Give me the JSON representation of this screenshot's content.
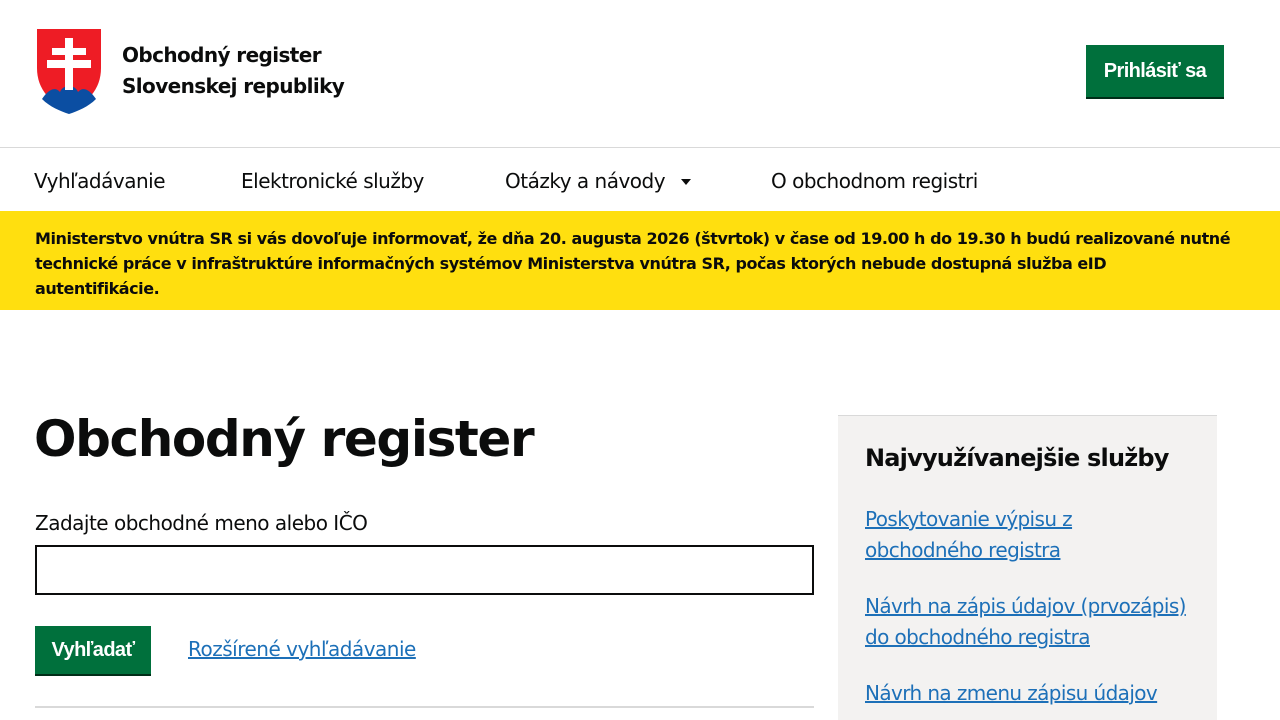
{
  "header": {
    "brand_line1": "Obchodný register",
    "brand_line2": "Slovenskej republiky",
    "login_label": "Prihlásiť sa",
    "logo_icon": "slovak-coat-of-arms",
    "accent_color": "#00703c"
  },
  "nav": {
    "items": [
      {
        "label": "Vyhľadávanie"
      },
      {
        "label": "Elektronické služby"
      },
      {
        "label": "Otázky a návody"
      },
      {
        "label": "O obchodnom registri"
      }
    ]
  },
  "notice": {
    "text": "Ministerstvo vnútra SR si vás dovoľuje informovať, že dňa 20. augusta 2026 (štvrtok) v čase od 19.00 h do 19.30 h budú realizované nutné technické práce v infraštruktúre informačných systémov Ministerstva vnútra SR, počas ktorých nebude dostupná služba eID autentifikácie.",
    "background_color": "#ffdf0f"
  },
  "main": {
    "title": "Obchodný register",
    "search_label": "Zadajte obchodné meno alebo IČO",
    "search_value": "",
    "search_button": "Vyhľadať",
    "advanced_link": "Rozšírené vyhľadávanie"
  },
  "sidebar": {
    "title": "Najvyužívanejšie služby",
    "links": [
      {
        "label": "Poskytovanie výpisu z obchodného registra"
      },
      {
        "label": "Návrh na zápis údajov (prvozápis) do obchodného registra"
      },
      {
        "label": "Návrh na zmenu zápisu údajov"
      }
    ]
  }
}
